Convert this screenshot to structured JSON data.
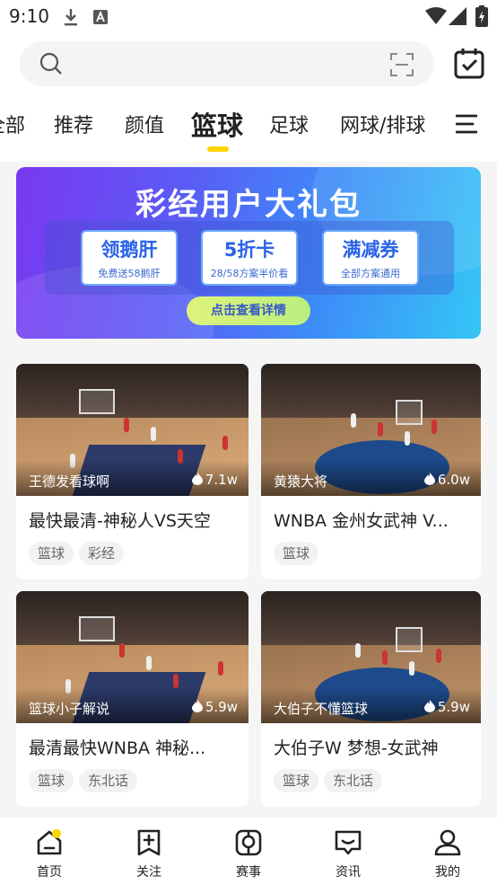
{
  "status_bar": {
    "time": "9:10"
  },
  "search": {
    "placeholder": ""
  },
  "tabs": [
    {
      "label": "全部"
    },
    {
      "label": "推荐"
    },
    {
      "label": "颜值"
    },
    {
      "label": "篮球",
      "active": true
    },
    {
      "label": "足球"
    },
    {
      "label": "网球/排球"
    }
  ],
  "banner": {
    "title": "彩经用户大礼包",
    "coupons": [
      {
        "main": "领鹅肝",
        "sub": "免费送58鹅肝"
      },
      {
        "main": "5折卡",
        "sub": "28/58方案半价看"
      },
      {
        "main": "满减券",
        "sub": "全部方案通用"
      }
    ],
    "cta": "点击查看详情"
  },
  "videos": [
    {
      "author": "王德发看球啊",
      "views": "7.1w",
      "title": "最快最清-神秘人VS天空",
      "tags": [
        "篮球",
        "彩经"
      ]
    },
    {
      "author": "黄猿大将",
      "views": "6.0w",
      "title": "WNBA 金州女武神 V...",
      "tags": [
        "篮球"
      ]
    },
    {
      "author": "篮球小子解说",
      "views": "5.9w",
      "title": "最清最快WNBA 神秘...",
      "tags": [
        "篮球",
        "东北话"
      ]
    },
    {
      "author": "大伯子不懂篮球",
      "views": "5.9w",
      "title": "大伯子W 梦想-女武神",
      "tags": [
        "篮球",
        "东北话"
      ]
    }
  ],
  "bottom_nav": [
    {
      "label": "首页",
      "icon": "home-icon",
      "active": true
    },
    {
      "label": "关注",
      "icon": "follow-icon"
    },
    {
      "label": "赛事",
      "icon": "match-icon"
    },
    {
      "label": "资讯",
      "icon": "news-icon"
    },
    {
      "label": "我的",
      "icon": "profile-icon"
    }
  ],
  "colors": {
    "accent": "#ffd500",
    "banner_start": "#7a38f0",
    "banner_end": "#35c6f5"
  }
}
